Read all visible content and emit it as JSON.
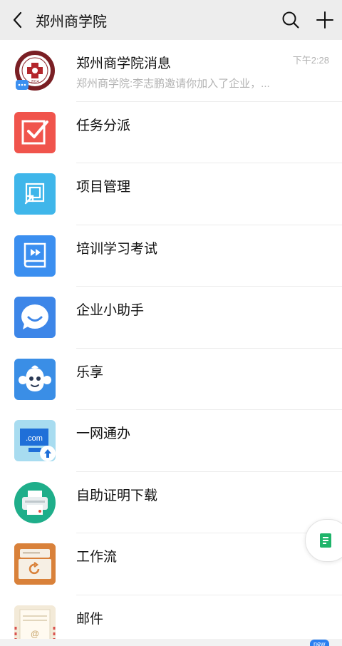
{
  "header": {
    "title": "郑州商学院"
  },
  "items": [
    {
      "name": "郑州商学院消息",
      "preview": "郑州商学院:李志鹏邀请你加入了企业，...",
      "time": "下午2:28",
      "icon": "school-logo-icon"
    },
    {
      "name": "任务分派",
      "icon": "task-check-icon"
    },
    {
      "name": "项目管理",
      "icon": "project-icon"
    },
    {
      "name": "培训学习考试",
      "icon": "training-book-icon"
    },
    {
      "name": "企业小助手",
      "icon": "assistant-chat-icon"
    },
    {
      "name": "乐享",
      "icon": "monkey-icon"
    },
    {
      "name": "一网通办",
      "icon": "dotcom-icon"
    },
    {
      "name": "自助证明下载",
      "icon": "printer-icon"
    },
    {
      "name": "工作流",
      "icon": "workflow-icon"
    },
    {
      "name": "邮件",
      "icon": "mail-icon"
    }
  ],
  "logo_text": "2014",
  "badge": {
    "label": "new"
  },
  "colors": {
    "header_bg": "#ededed",
    "task_red": "#f0544c",
    "project_blue": "#3fb6ea",
    "training_blue": "#3b8ff0",
    "assistant_blue": "#3d86e8",
    "monkey_blue": "#3a8ee6",
    "printer_green": "#1fae8a",
    "workflow_orange": "#e08a3c"
  }
}
